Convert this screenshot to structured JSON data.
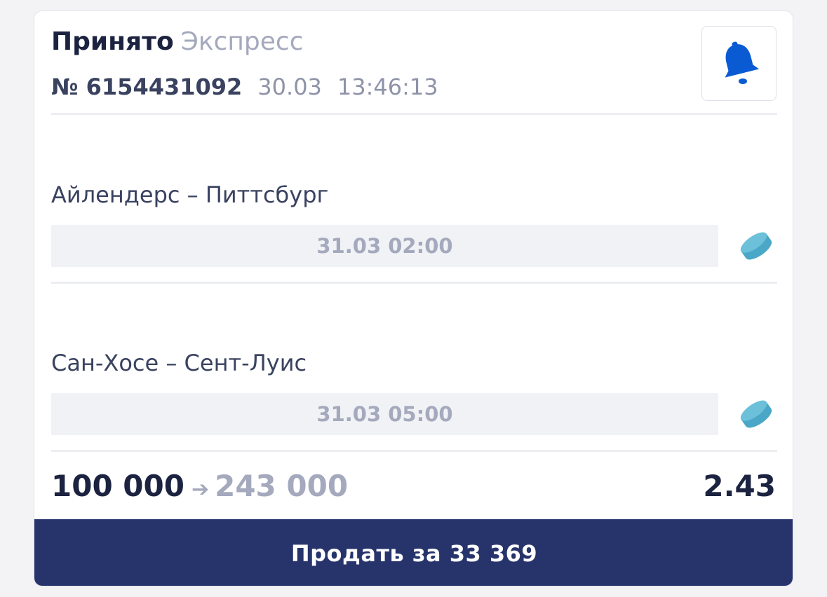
{
  "header": {
    "status": "Принято",
    "bet_type": "Экспресс",
    "number": "№ 6154431092",
    "date": "30.03",
    "time": "13:46:13",
    "bell_icon": "bell-icon"
  },
  "events": [
    {
      "title": "Айлендерс – Питтсбург",
      "datetime": "31.03 02:00",
      "sport_icon": "hockey-puck-icon"
    },
    {
      "title": "Сан-Хосе – Сент-Луис",
      "datetime": "31.03 05:00",
      "sport_icon": "hockey-puck-icon"
    }
  ],
  "summary": {
    "stake": "100 000",
    "arrow": "➔",
    "payout": "243 000",
    "coefficient": "2.43"
  },
  "sell_button": {
    "label": "Продать за 33 369"
  },
  "colors": {
    "accent_blue": "#0a5bd3",
    "button_bg": "#27346c",
    "puck_color": "#4aa7c7",
    "text_dark": "#1c2340",
    "text_muted": "#a4a9bd"
  }
}
